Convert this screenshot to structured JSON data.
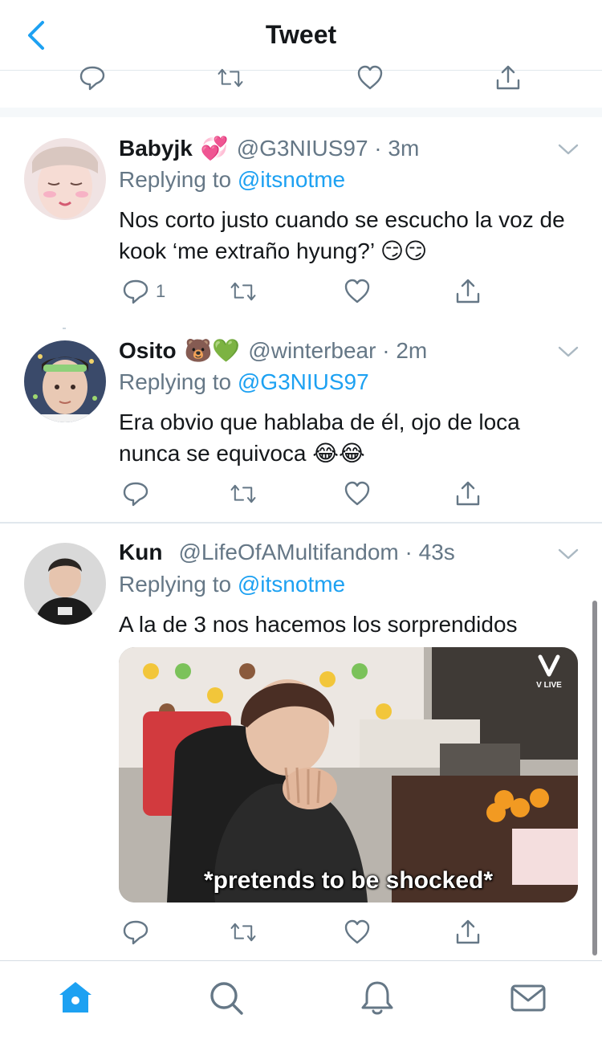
{
  "header": {
    "title": "Tweet"
  },
  "colors": {
    "accent": "#1da1f2",
    "muted": "#657786",
    "text": "#14171a",
    "divider": "#e1e8ed"
  },
  "icons": [
    "back-chevron-icon",
    "reply-icon",
    "retweet-icon",
    "like-icon",
    "share-icon",
    "more-chevron-icon",
    "home-icon",
    "search-icon",
    "notifications-icon",
    "messages-icon"
  ],
  "tweets": [
    {
      "name": "Babyjk",
      "emoji": "💞",
      "handle": "@G3NIUS97 · 3m",
      "reply_prefix": "Replying to",
      "reply_to": "@itsnotme",
      "text": "Nos corto justo cuando se escucho la voz de kook ‘me extraño hyung?’ 😏😏",
      "reply_count": "1"
    },
    {
      "name": "Osito",
      "emoji": "🐻💚",
      "handle": "@winterbear · 2m",
      "reply_prefix": "Replying to",
      "reply_to": "@G3NIUS97",
      "text": "Era obvio que hablaba de él, ojo de loca nunca se equivoca 😂😂",
      "reply_count": ""
    },
    {
      "name": "Kun",
      "emoji": "",
      "handle": "@LifeOfAMultifandom · 43s",
      "reply_prefix": "Replying to",
      "reply_to": "@itsnotme",
      "text": "A la de 3 nos hacemos los sorprendidos",
      "reply_count": "",
      "media": {
        "caption": "*pretends to be shocked*",
        "watermark": "V LIVE"
      }
    }
  ]
}
